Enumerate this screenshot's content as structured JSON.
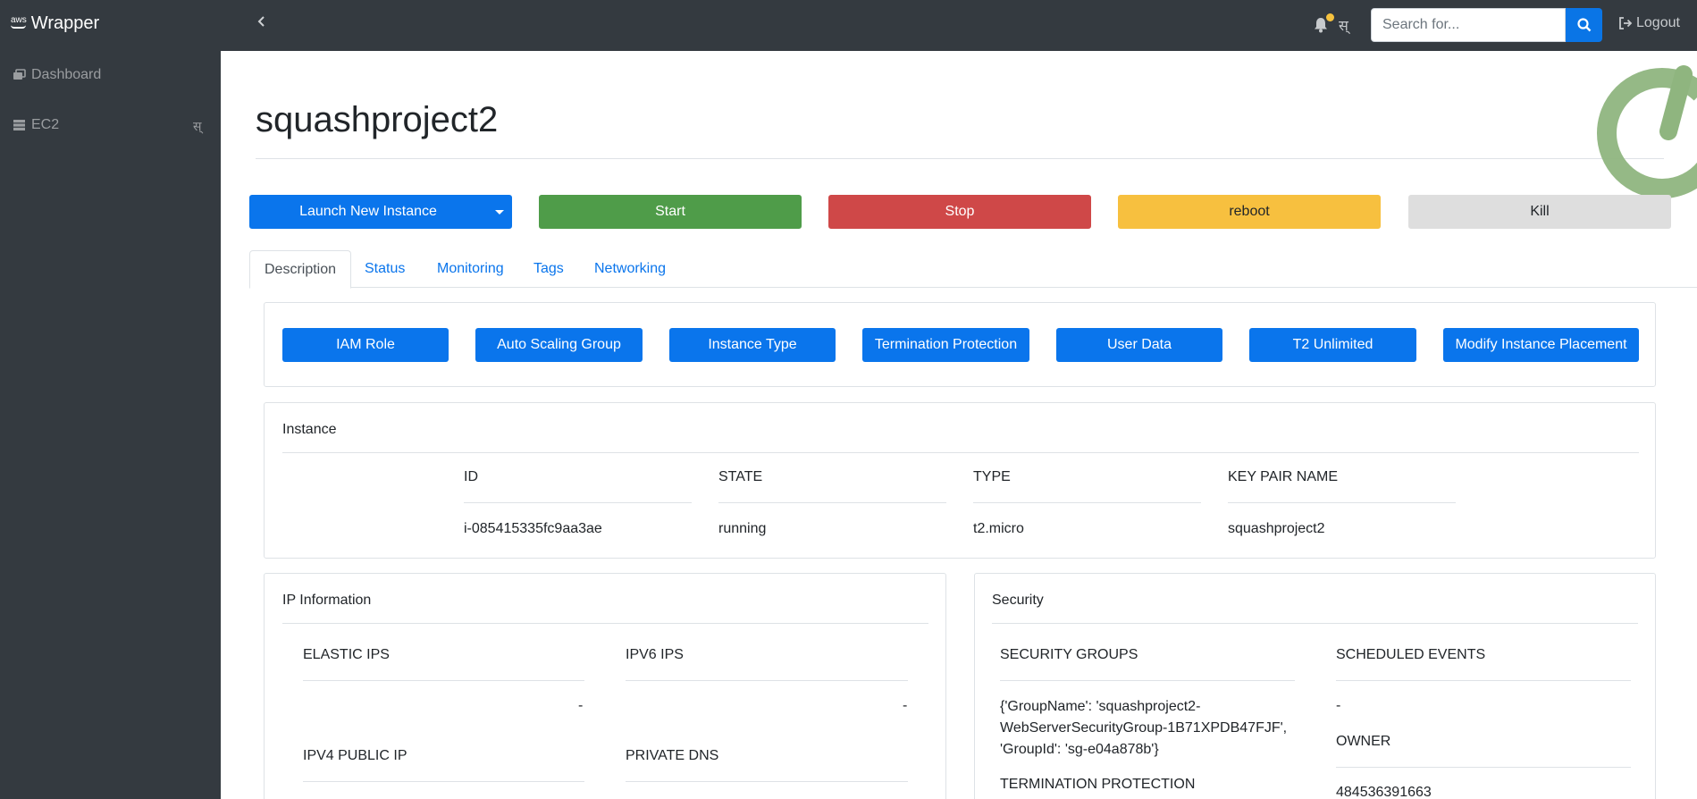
{
  "app": {
    "brand_logo_text": "aws",
    "brand_name": "Wrapper"
  },
  "navbar": {
    "language_glyph": "स्",
    "search_placeholder": "Search for...",
    "logout_label": "Logout"
  },
  "sidebar": {
    "items": [
      {
        "label": "Dashboard"
      },
      {
        "label": "EC2",
        "badge": "स्"
      }
    ]
  },
  "page": {
    "title": "squashproject2"
  },
  "actions": {
    "launch": "Launch New Instance",
    "start": "Start",
    "stop": "Stop",
    "reboot": "reboot",
    "kill": "Kill"
  },
  "tabs": [
    "Description",
    "Status",
    "Monitoring",
    "Tags",
    "Networking"
  ],
  "modify_buttons": [
    "IAM Role",
    "Auto Scaling Group",
    "Instance Type",
    "Termination Protection",
    "User Data",
    "T2 Unlimited",
    "Modify Instance Placement"
  ],
  "instance": {
    "title": "Instance",
    "headers": [
      "ID",
      "STATE",
      "TYPE",
      "KEY PAIR NAME"
    ],
    "values": [
      "i-085415335fc9aa3ae",
      "running",
      "t2.micro",
      "squashproject2"
    ]
  },
  "ip_info": {
    "title": "IP Information",
    "elastic_ips_label": "ELASTIC IPS",
    "elastic_ips_value": "-",
    "ipv6_ips_label": "IPV6 IPS",
    "ipv6_ips_value": "-",
    "ipv4_public_label": "IPV4 PUBLIC IP",
    "private_dns_label": "PRIVATE DNS"
  },
  "security": {
    "title": "Security",
    "security_groups_label": "SECURITY GROUPS",
    "security_groups_value": "{'GroupName': 'squashproject2-WebServerSecurityGroup-1B71XPDB47FJF', 'GroupId': 'sg-e04a878b'}",
    "scheduled_events_label": "SCHEDULED EVENTS",
    "scheduled_events_value": "-",
    "owner_label": "OWNER",
    "owner_value": "484536391663",
    "termination_protection_label": "TERMINATION PROTECTION"
  },
  "colors": {
    "primary": "#0a75ec",
    "success": "#4f9c49",
    "danger": "#cf4848",
    "warning": "#f7c03f",
    "light": "#dedede",
    "navbar": "#343a40",
    "power_icon": "#8fb57f"
  },
  "icons": [
    "aws-logo",
    "chevron-left-icon",
    "bell-icon",
    "search-icon",
    "logout-icon",
    "dashboard-icon",
    "server-icon",
    "power-icon"
  ]
}
